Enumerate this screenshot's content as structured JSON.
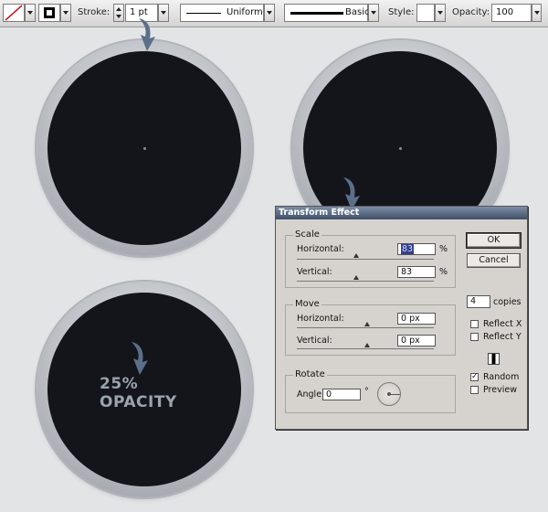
{
  "toolbar": {
    "stroke_label": "Stroke:",
    "stroke_weight": "1 pt",
    "profile_value": "Uniform",
    "brush_value": "Basic",
    "style_label": "Style:",
    "opacity_label": "Opacity:",
    "opacity_value": "100"
  },
  "canvas": {
    "annotation_text": "25% OPACITY",
    "inner_color": "#14151a",
    "ring_color": "#c8cbd0",
    "arrow_color": "#5b6f8a"
  },
  "dialog": {
    "title": "Transform Effect",
    "scale": {
      "title": "Scale",
      "horizontal_label": "Horizontal:",
      "horizontal_value": "83",
      "vertical_label": "Vertical:",
      "vertical_value": "83",
      "unit": "%",
      "horizontal_slider_fraction": 0.5,
      "vertical_slider_fraction": 0.5
    },
    "move": {
      "title": "Move",
      "horizontal_label": "Horizontal:",
      "horizontal_value": "0 px",
      "vertical_label": "Vertical:",
      "vertical_value": "0 px"
    },
    "rotate": {
      "title": "Rotate",
      "angle_label": "Angle:",
      "angle_value": "0",
      "degree_symbol": "°"
    },
    "ok_label": "OK",
    "cancel_label": "Cancel",
    "copies_value": "4",
    "copies_label": "copies",
    "reflect_x_label": "Reflect X",
    "reflect_y_label": "Reflect Y",
    "random_label": "Random",
    "preview_label": "Preview",
    "reflect_x_checked": false,
    "reflect_y_checked": false,
    "random_checked": true,
    "preview_checked": false
  }
}
